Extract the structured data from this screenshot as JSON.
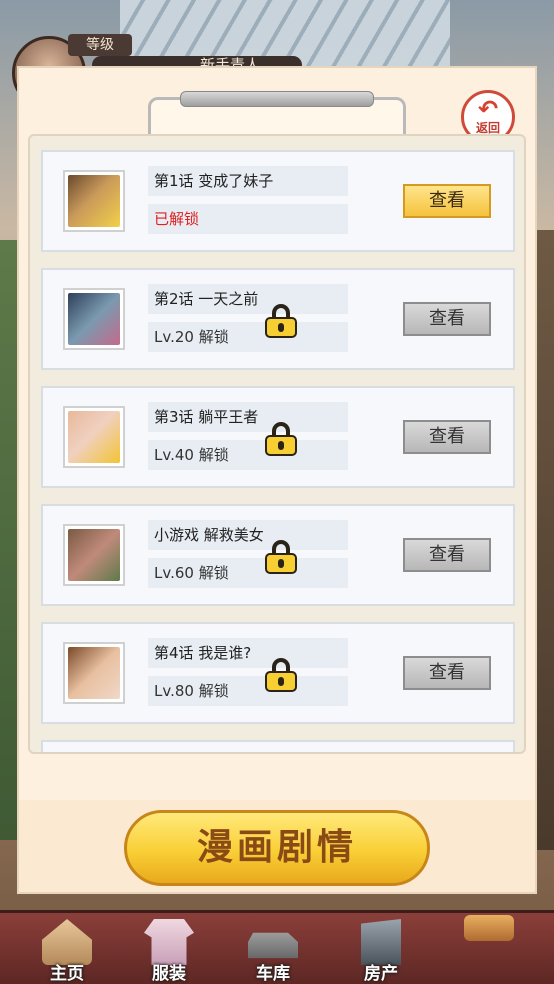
{
  "header": {
    "level_label": "等级",
    "level_title": "新手青人"
  },
  "modal": {
    "back_label": "返回",
    "main_button": "漫画剧情"
  },
  "episodes": [
    {
      "title": "第1话 变成了妹子",
      "status": "已解锁",
      "unlocked": true,
      "button": "查看"
    },
    {
      "title": "第2话 一天之前",
      "status": "Lv.20 解锁",
      "unlocked": false,
      "button": "查看"
    },
    {
      "title": "第3话 躺平王者",
      "status": "Lv.40 解锁",
      "unlocked": false,
      "button": "查看"
    },
    {
      "title": "小游戏 解救美女",
      "status": "Lv.60 解锁",
      "unlocked": false,
      "button": "查看"
    },
    {
      "title": "第4话 我是谁?",
      "status": "Lv.80 解锁",
      "unlocked": false,
      "button": "查看"
    }
  ],
  "nav": {
    "items": [
      {
        "label": "主页",
        "icon": "home-icon"
      },
      {
        "label": "服装",
        "icon": "clothing-icon"
      },
      {
        "label": "车库",
        "icon": "car-icon"
      },
      {
        "label": "房产",
        "icon": "building-icon"
      },
      {
        "label": "",
        "icon": "gift-icon"
      }
    ]
  },
  "colors": {
    "unlocked_status": "#e02020",
    "active_button": "#f5c23c",
    "nav_bg": "#8b3f3a"
  }
}
